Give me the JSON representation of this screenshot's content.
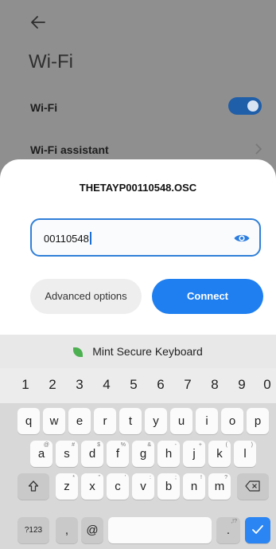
{
  "settings_bg": {
    "title": "Wi-Fi",
    "rows": [
      {
        "label": "Wi-Fi"
      },
      {
        "label": "Wi-Fi assistant"
      }
    ]
  },
  "dialog": {
    "ssid": "THETAYP00110548.OSC",
    "password_value": "00110548",
    "advanced_label": "Advanced options",
    "connect_label": "Connect"
  },
  "keyboard": {
    "brand": "Mint Secure Keyboard",
    "digits": [
      "1",
      "2",
      "3",
      "4",
      "5",
      "6",
      "7",
      "8",
      "9",
      "0"
    ],
    "row1": [
      "q",
      "w",
      "e",
      "r",
      "t",
      "y",
      "u",
      "i",
      "o",
      "p"
    ],
    "row2": [
      "a",
      "s",
      "d",
      "f",
      "g",
      "h",
      "j",
      "k",
      "l"
    ],
    "row2_hints": [
      "@",
      "#",
      "$",
      "%",
      "&",
      "-",
      "+",
      "(",
      ")"
    ],
    "row3": [
      "z",
      "x",
      "c",
      "v",
      "b",
      "n",
      "m"
    ],
    "row3_hints": [
      "*",
      "\"",
      "'",
      ":",
      ";",
      "!",
      "?"
    ],
    "sym_label": "?123",
    "comma_label": ",",
    "at_label": "@",
    "period_label": ".",
    "period_hint": ",!?"
  },
  "colors": {
    "accent": "#1f7ff0",
    "toggle_on": "#1f5ea8",
    "brand_leaf": "#4cb050"
  }
}
